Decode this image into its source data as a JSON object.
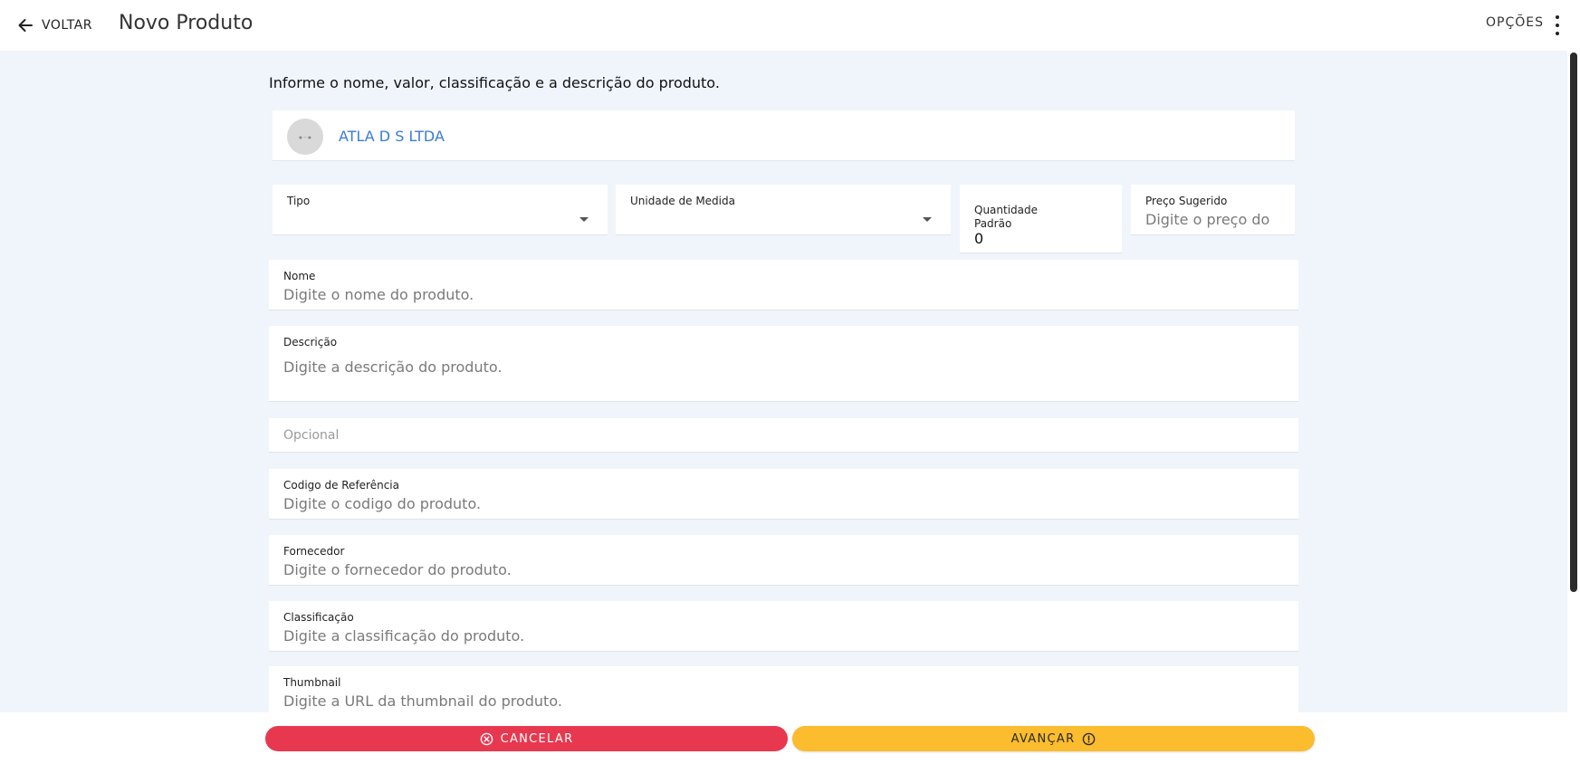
{
  "header": {
    "back_label": "VOLTAR",
    "title": "Novo Produto",
    "options_label": "OPÇÕES"
  },
  "instructions": "Informe o nome, valor, classificação e a descrição do produto.",
  "company": {
    "name": "ATLA D S LTDA"
  },
  "fields": {
    "tipo": {
      "label": "Tipo",
      "value": ""
    },
    "unidade": {
      "label": "Unidade de Medida",
      "value": ""
    },
    "quantidade": {
      "label": "Quantidade Padrão",
      "value": "0"
    },
    "preco": {
      "label": "Preço Sugerido",
      "placeholder": "Digite o preço do"
    },
    "nome": {
      "label": "Nome",
      "placeholder": "Digite o nome do produto."
    },
    "descricao": {
      "label": "Descrição",
      "placeholder": "Digite a descrição do produto."
    },
    "opcional": {
      "placeholder": "Opcional"
    },
    "codigo": {
      "label": "Codigo de Referência",
      "placeholder": "Digite o codigo do produto."
    },
    "fornecedor": {
      "label": "Fornecedor",
      "placeholder": "Digite o fornecedor do produto."
    },
    "classificacao": {
      "label": "Classificação",
      "placeholder": "Digite a classificação do produto."
    },
    "thumbnail": {
      "label": "Thumbnail",
      "placeholder": "Digite a URL da thumbnail do produto."
    }
  },
  "actions": {
    "cancel_label": "CANCELAR",
    "next_label": "AVANÇAR"
  },
  "colors": {
    "accent_blue": "#3a7ad9",
    "cancel_red": "#e8384f",
    "next_yellow": "#fbbc2d",
    "background": "#f0f5fc"
  }
}
